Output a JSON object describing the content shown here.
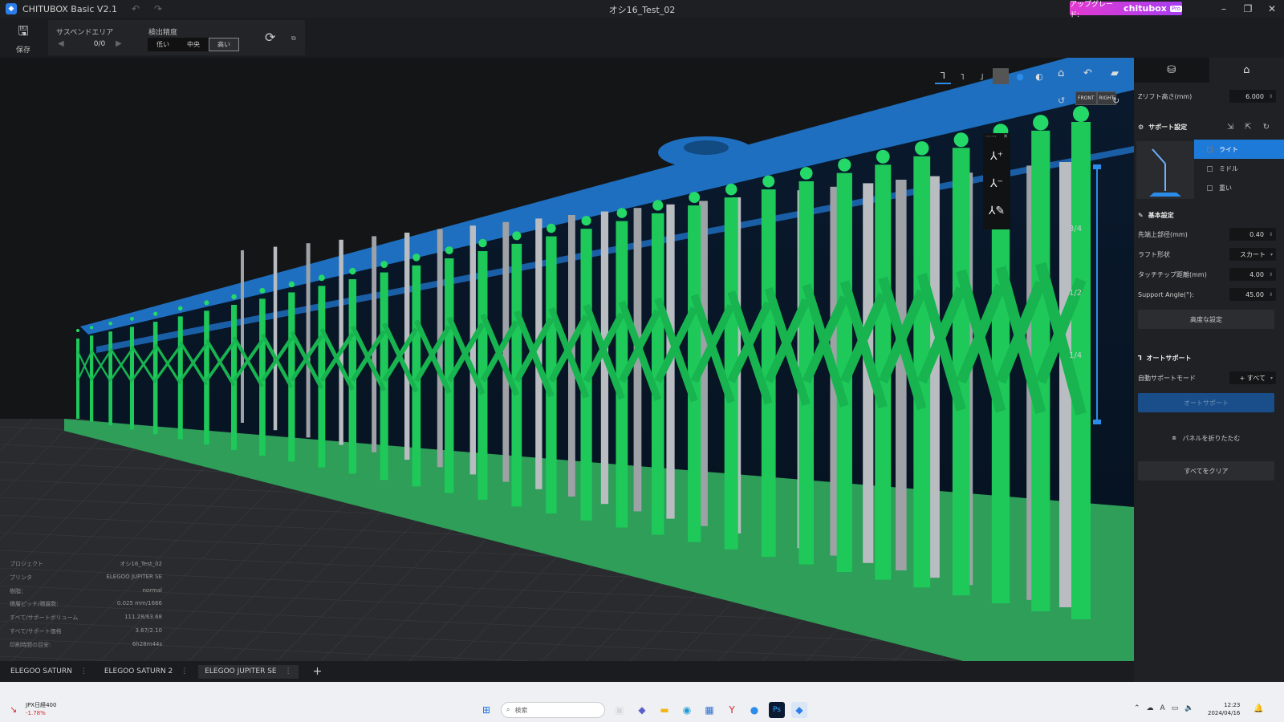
{
  "app": {
    "title": "CHITUBOX Basic V2.1",
    "document_title": "オシ16_Test_02",
    "upgrade_label": "アップグレード:",
    "upgrade_brand": "chitubox",
    "upgrade_tier": "Pro"
  },
  "toolbar": {
    "save_label": "保存",
    "suspend_area_label": "サスペンドエリア",
    "suspend_count": "0/0",
    "detection_label": "検出精度",
    "detection_options": [
      "低い",
      "中央",
      "高い"
    ],
    "detection_selected": "高い"
  },
  "viewport": {
    "view_cube": {
      "front": "FRONT",
      "right": "RIGHT"
    },
    "slider_labels": [
      "3/4",
      "1/2",
      "1/4"
    ]
  },
  "project_info": [
    {
      "key": "プロジェクト",
      "value": "オシ16_Test_02"
    },
    {
      "key": "プリンタ",
      "value": "ELEGOO JUPITER SE"
    },
    {
      "key": "樹脂：",
      "value": "normal"
    },
    {
      "key": "積層ピッチ/積層数:",
      "value": "0.025 mm/1666"
    },
    {
      "key": "すべて/サポートボリューム",
      "value": "111.28/63.68"
    },
    {
      "key": "すべて/サポート価格",
      "value": "3.67/2.10"
    },
    {
      "key": "印刷時間の目安:",
      "value": "6h28m44s"
    }
  ],
  "printer_tabs": [
    "ELEGOO SATURN",
    "ELEGOO SATURN 2",
    "ELEGOO JUPITER SE"
  ],
  "printer_tab_active": 2,
  "right_panel": {
    "z_lift_label": "Zリフト高さ(mm)",
    "z_lift_value": "6.000",
    "support_settings_label": "サポート設定",
    "presets": [
      "ライト",
      "ミドル",
      "重い"
    ],
    "preset_active": 0,
    "basic_settings_label": "基本設定",
    "tip_top_label": "先端上部径(mm)",
    "tip_top_value": "0.40",
    "raft_shape_label": "ラフト形状",
    "raft_shape_value": "スカート",
    "touch_tip_label": "タッチチップ距離(mm)",
    "touch_tip_value": "4.00",
    "support_angle_label": "Support Angle(°):",
    "support_angle_value": "45.00",
    "advanced_label": "高度な設定",
    "auto_support_label": "オートサポート",
    "auto_mode_label": "自動サポートモード",
    "auto_mode_value": "+ すべて",
    "auto_support_button": "オートサポート",
    "collapse_label": "パネルを折りたたむ",
    "clear_all_label": "すべてをクリア"
  },
  "taskbar": {
    "ticker_name": "JPX日経400",
    "ticker_change": "-1.78%",
    "search_placeholder": "検索",
    "time": "12:23",
    "date": "2024/04/16"
  },
  "colors": {
    "accent": "#2b8de9",
    "support_green": "#1ec95a",
    "model_blue": "#1f6fc0",
    "upgrade_pink": "#e33ad1"
  }
}
